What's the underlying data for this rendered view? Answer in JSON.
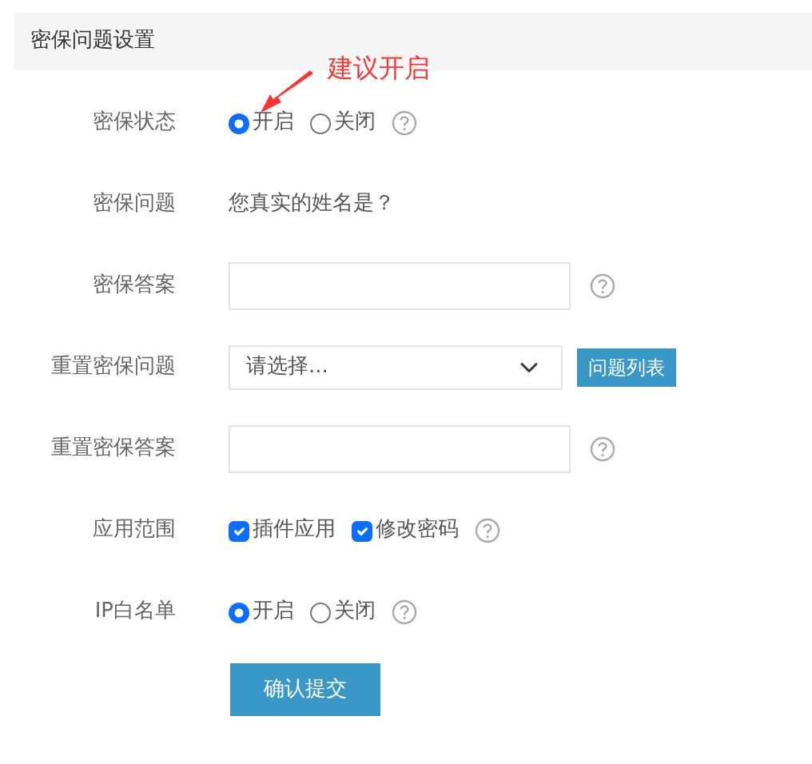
{
  "header": {
    "title": "密保问题设置"
  },
  "annotation": {
    "text": "建议开启"
  },
  "fields": [
    {
      "kind": "radio",
      "label": "密保状态",
      "options": [
        {
          "label": "开启",
          "selected": true
        },
        {
          "label": "关闭",
          "selected": false
        }
      ],
      "help": true
    },
    {
      "kind": "text",
      "label": "密保问题",
      "value": "您真实的姓名是？"
    },
    {
      "kind": "input",
      "label": "密保答案",
      "help": true
    },
    {
      "kind": "select",
      "label": "重置密保问题",
      "value": "请选择...",
      "button": "问题列表"
    },
    {
      "kind": "input",
      "label": "重置密保答案",
      "help": true
    },
    {
      "kind": "checks",
      "label": "应用范围",
      "options": [
        {
          "label": "插件应用",
          "checked": true
        },
        {
          "label": "修改密码",
          "checked": true
        }
      ],
      "help": true
    },
    {
      "kind": "radio",
      "label": "IP白名单",
      "options": [
        {
          "label": "开启",
          "selected": true
        },
        {
          "label": "关闭",
          "selected": false
        }
      ],
      "help": true
    }
  ],
  "submit": "确认提交"
}
